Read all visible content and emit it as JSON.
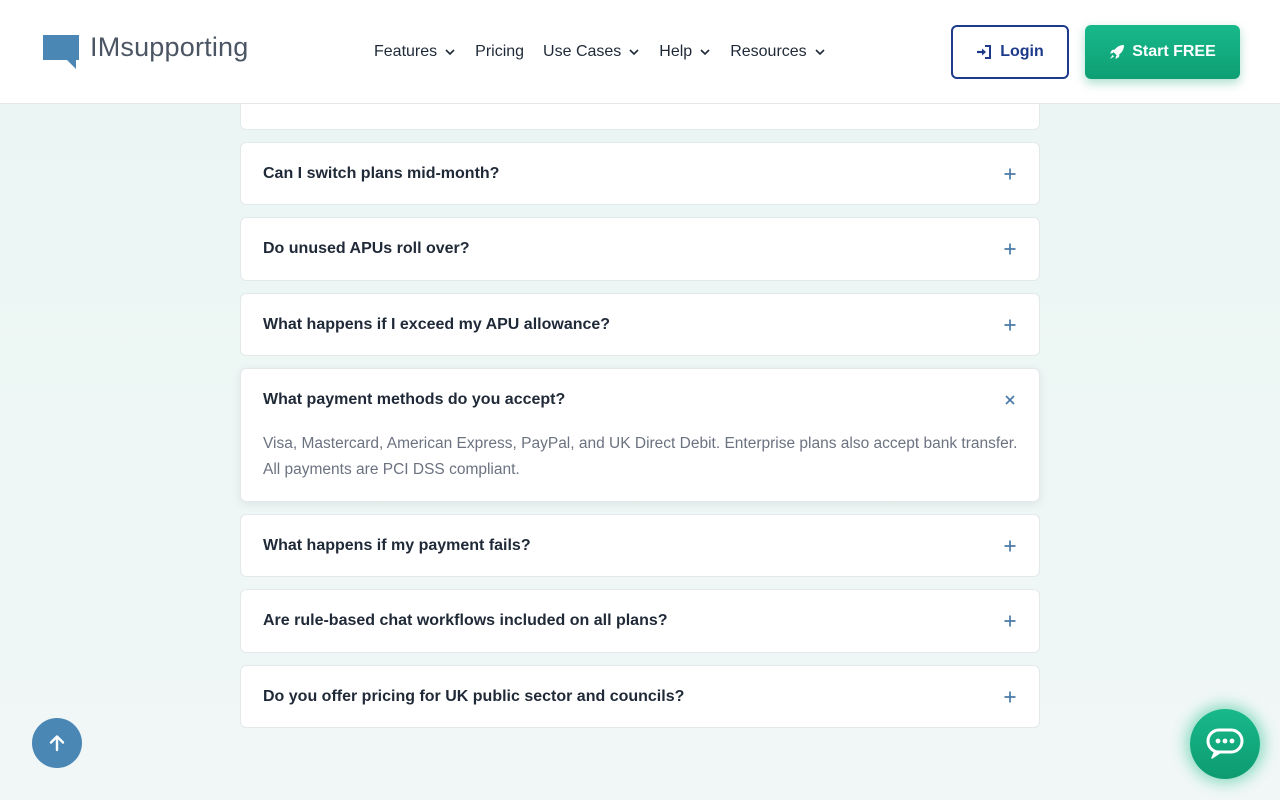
{
  "brand": {
    "name": "IMsupporting",
    "logo_color": "#4a87b5"
  },
  "nav": {
    "items": [
      {
        "label": "Features",
        "has_dropdown": true
      },
      {
        "label": "Pricing",
        "has_dropdown": false
      },
      {
        "label": "Use Cases",
        "has_dropdown": true
      },
      {
        "label": "Help",
        "has_dropdown": true
      },
      {
        "label": "Resources",
        "has_dropdown": true
      }
    ],
    "login_label": "Login",
    "start_label": "Start FREE"
  },
  "colors": {
    "accent_green": "#10b981",
    "navy": "#1e3a8a",
    "scroll_blue": "#4a87b5"
  },
  "faq": {
    "items": [
      {
        "question": "Can I switch plans mid-month?",
        "open": false
      },
      {
        "question": "Do unused APUs roll over?",
        "open": false
      },
      {
        "question": "What happens if I exceed my APU allowance?",
        "open": false
      },
      {
        "question": "What payment methods do you accept?",
        "open": true,
        "answer": "Visa, Mastercard, American Express, PayPal, and UK Direct Debit. Enterprise plans also accept bank transfer. All payments are PCI DSS compliant."
      },
      {
        "question": "What happens if my payment fails?",
        "open": false
      },
      {
        "question": "Are rule-based chat workflows included on all plans?",
        "open": false
      },
      {
        "question": "Do you offer pricing for UK public sector and councils?",
        "open": false
      }
    ]
  },
  "icons": {
    "collapsed": "plus-icon",
    "expanded": "close-icon",
    "scroll_top": "arrow-up-icon",
    "chat": "chat-bubble-icon"
  }
}
